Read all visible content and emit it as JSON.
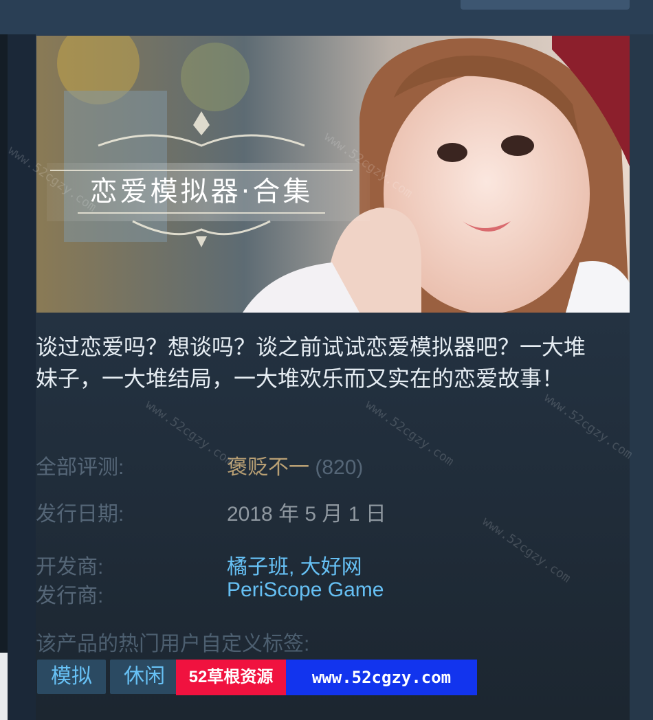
{
  "capsule": {
    "title": "恋爱模拟器·合集"
  },
  "description": "谈过恋爱吗？想谈吗？谈之前试试恋爱模拟器吧？一大堆妹子，一大堆结局，一大堆欢乐而又实在的恋爱故事！",
  "reviews": {
    "label": "全部评测:",
    "summary": "褒贬不一",
    "count": "(820)"
  },
  "release": {
    "label": "发行日期:",
    "date": "2018 年 5 月 1 日"
  },
  "developer": {
    "label": "开发商:",
    "names": [
      "橘子班",
      "大好网"
    ],
    "separator": ", "
  },
  "publisher": {
    "label": "发行商:",
    "name": "PeriScope Game"
  },
  "tags": {
    "label": "该产品的热门用户自定义标签:",
    "items": [
      "模拟",
      "休闲"
    ]
  },
  "watermark": {
    "badge_left": "52草根资源",
    "badge_right": "www.52cgzy.com",
    "overlay": "www.52cgzy.com"
  },
  "colors": {
    "review_mixed": "#b9a074",
    "link": "#66c0f4",
    "tag_bg": "#2b4a62"
  }
}
